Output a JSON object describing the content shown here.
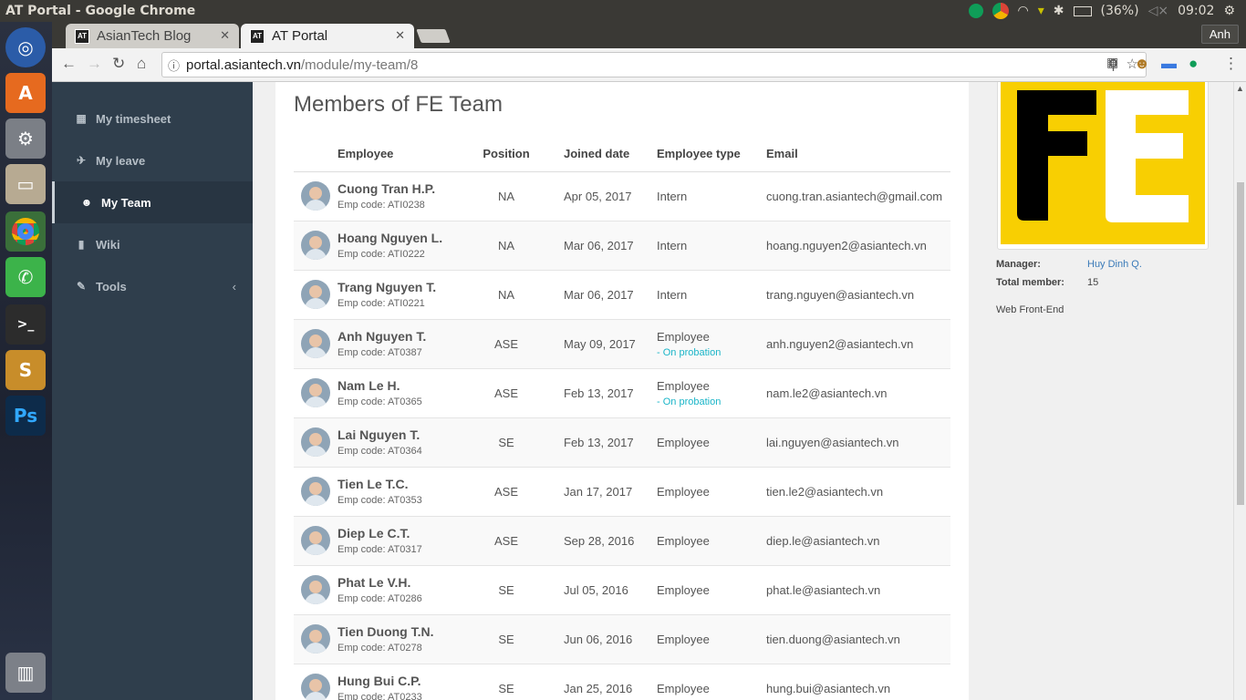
{
  "window_title": "AT Portal - Google Chrome",
  "tray": {
    "battery": "(36%)",
    "time": "09:02",
    "user": "Anh"
  },
  "tabs": [
    {
      "label": "AsianTech Blog",
      "active": false
    },
    {
      "label": "AT Portal",
      "active": true
    }
  ],
  "url": {
    "host": "portal.asiantech.vn",
    "path": "/module/my-team/8"
  },
  "sidebar": {
    "items": [
      {
        "label": "My timesheet",
        "icon": "calendar-icon"
      },
      {
        "label": "My leave",
        "icon": "plane-icon"
      },
      {
        "label": "My Team",
        "icon": "users-icon",
        "active": true
      },
      {
        "label": "Wiki",
        "icon": "book-icon"
      },
      {
        "label": "Tools",
        "icon": "wrench-icon"
      }
    ]
  },
  "page_title": "Members of FE Team",
  "table": {
    "headers": [
      "Employee",
      "Position",
      "Joined date",
      "Employee type",
      "Email"
    ],
    "rows": [
      {
        "name": "Cuong Tran H.P.",
        "code": "Emp code: ATI0238",
        "position": "NA",
        "joined": "Apr 05, 2017",
        "type": "Intern",
        "probation": "",
        "email": "cuong.tran.asiantech@gmail.com"
      },
      {
        "name": "Hoang Nguyen L.",
        "code": "Emp code: ATI0222",
        "position": "NA",
        "joined": "Mar 06, 2017",
        "type": "Intern",
        "probation": "",
        "email": "hoang.nguyen2@asiantech.vn"
      },
      {
        "name": "Trang Nguyen T.",
        "code": "Emp code: ATI0221",
        "position": "NA",
        "joined": "Mar 06, 2017",
        "type": "Intern",
        "probation": "",
        "email": "trang.nguyen@asiantech.vn"
      },
      {
        "name": "Anh Nguyen T.",
        "code": "Emp code: AT0387",
        "position": "ASE",
        "joined": "May 09, 2017",
        "type": "Employee",
        "probation": "- On probation",
        "email": "anh.nguyen2@asiantech.vn"
      },
      {
        "name": "Nam Le H.",
        "code": "Emp code: AT0365",
        "position": "ASE",
        "joined": "Feb 13, 2017",
        "type": "Employee",
        "probation": "- On probation",
        "email": "nam.le2@asiantech.vn"
      },
      {
        "name": "Lai Nguyen T.",
        "code": "Emp code: AT0364",
        "position": "SE",
        "joined": "Feb 13, 2017",
        "type": "Employee",
        "probation": "",
        "email": "lai.nguyen@asiantech.vn"
      },
      {
        "name": "Tien Le T.C.",
        "code": "Emp code: AT0353",
        "position": "ASE",
        "joined": "Jan 17, 2017",
        "type": "Employee",
        "probation": "",
        "email": "tien.le2@asiantech.vn"
      },
      {
        "name": "Diep Le C.T.",
        "code": "Emp code: AT0317",
        "position": "ASE",
        "joined": "Sep 28, 2016",
        "type": "Employee",
        "probation": "",
        "email": "diep.le@asiantech.vn"
      },
      {
        "name": "Phat Le V.H.",
        "code": "Emp code: AT0286",
        "position": "SE",
        "joined": "Jul 05, 2016",
        "type": "Employee",
        "probation": "",
        "email": "phat.le@asiantech.vn"
      },
      {
        "name": "Tien Duong T.N.",
        "code": "Emp code: AT0278",
        "position": "SE",
        "joined": "Jun 06, 2016",
        "type": "Employee",
        "probation": "",
        "email": "tien.duong@asiantech.vn"
      },
      {
        "name": "Hung Bui C.P.",
        "code": "Emp code: AT0233",
        "position": "SE",
        "joined": "Jan 25, 2016",
        "type": "Employee",
        "probation": "",
        "email": "hung.bui@asiantech.vn"
      }
    ]
  },
  "team_info": {
    "logo_text": "FE",
    "manager_label": "Manager:",
    "manager": "Huy Dinh Q.",
    "total_label": "Total member:",
    "total": "15",
    "description": "Web Front-End"
  },
  "colors": {
    "sidebar": "#2f3e4c",
    "logo_bg": "#f8cf02",
    "probation": "#1ab5c8",
    "link": "#3a7ab8"
  }
}
